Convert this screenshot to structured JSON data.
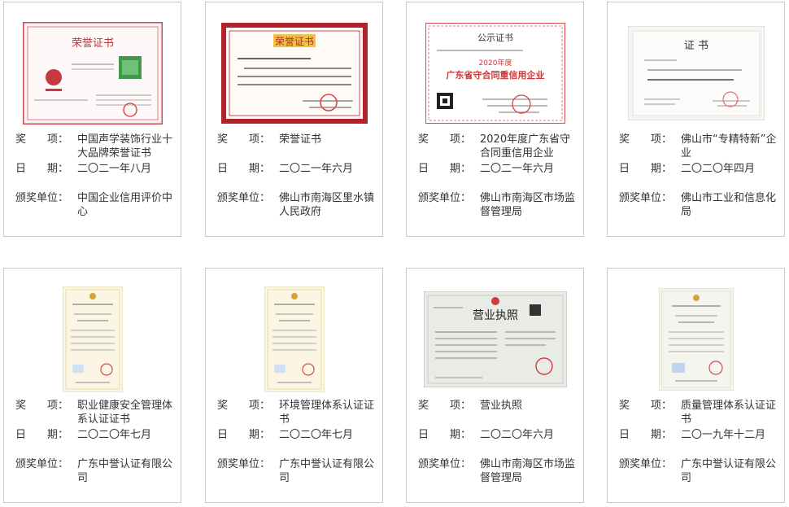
{
  "labels": {
    "award": "奖　　项：",
    "date": "日　　期：",
    "issuer": "颁奖单位："
  },
  "cards": [
    {
      "image": "honor-certificate-red-green",
      "image_title": "荣誉证书",
      "award": "中国声学装饰行业十大品牌荣誉证书",
      "date": "二〇二一年八月",
      "issuer": "中国企业信用评价中心"
    },
    {
      "image": "honor-certificate-red-border",
      "image_title": "荣誉证书",
      "award": "荣誉证书",
      "date": "二〇二一年六月",
      "issuer": "佛山市南海区里水镇人民政府"
    },
    {
      "image": "public-notice-certificate",
      "image_title": "公示证书",
      "image_subtitle": "2020年度",
      "image_headline": "广东省守合同重信用企业",
      "award": "2020年度广东省守合同重信用企业",
      "date": "二〇二一年六月",
      "issuer": "佛山市南海区市场监督管理局"
    },
    {
      "image": "certificate-plain",
      "image_title": "证  书",
      "award": "佛山市“专精特新”企业",
      "date": "二〇二〇年四月",
      "issuer": "佛山市工业和信息化局"
    },
    {
      "image": "system-certificate-yellow",
      "award": "职业健康安全管理体系认证证书",
      "date": "二〇二〇年七月",
      "issuer": "广东中誉认证有限公司"
    },
    {
      "image": "system-certificate-yellow",
      "award": "环境管理体系认证证书",
      "date": "二〇二〇年七月",
      "issuer": "广东中誉认证有限公司"
    },
    {
      "image": "business-license",
      "image_title": "营业执照",
      "award": "营业执照",
      "date": "二〇二〇年六月",
      "issuer": "佛山市南海区市场监督管理局"
    },
    {
      "image": "system-certificate-yellow",
      "award": "质量管理体系认证证书",
      "date": "二〇一九年十二月",
      "issuer": "广东中誉认证有限公司"
    }
  ]
}
